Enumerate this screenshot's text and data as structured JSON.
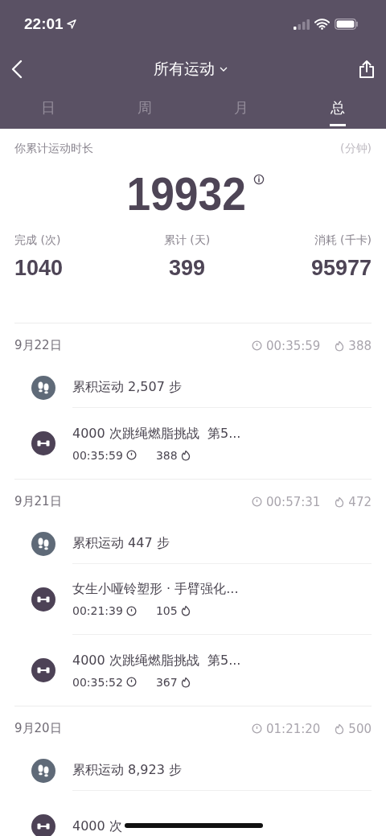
{
  "status_bar": {
    "time": "22:01"
  },
  "nav": {
    "title": "所有运动"
  },
  "tabs": [
    {
      "label": "日",
      "selected": false
    },
    {
      "label": "周",
      "selected": false
    },
    {
      "label": "月",
      "selected": false
    },
    {
      "label": "总",
      "selected": true
    }
  ],
  "summary": {
    "label": "你累计运动时长",
    "unit": "(分钟)",
    "total": "19932",
    "stats": [
      {
        "label": "完成 (次)",
        "value": "1040"
      },
      {
        "label": "累计 (天)",
        "value": "399"
      },
      {
        "label": "消耗 (千卡)",
        "value": "95977"
      }
    ]
  },
  "days": [
    {
      "date": "9月22日",
      "duration": "00:35:59",
      "calories": "388",
      "items": [
        {
          "kind": "steps",
          "title": "累积运动 2,507 步"
        },
        {
          "kind": "workout",
          "title": "4000 次跳绳燃脂挑战  第5...",
          "duration": "00:35:59",
          "calories": "388"
        }
      ]
    },
    {
      "date": "9月21日",
      "duration": "00:57:31",
      "calories": "472",
      "items": [
        {
          "kind": "steps",
          "title": "累积运动 447 步"
        },
        {
          "kind": "workout",
          "title": "女生小哑铃塑形 · 手臂强化...",
          "duration": "00:21:39",
          "calories": "105"
        },
        {
          "kind": "workout",
          "title": "4000 次跳绳燃脂挑战  第5...",
          "duration": "00:35:52",
          "calories": "367"
        }
      ]
    },
    {
      "date": "9月20日",
      "duration": "01:21:20",
      "calories": "500",
      "items": [
        {
          "kind": "steps",
          "title": "累积运动 8,923 步"
        },
        {
          "kind": "workout",
          "title": "4000 次"
        }
      ]
    }
  ]
}
